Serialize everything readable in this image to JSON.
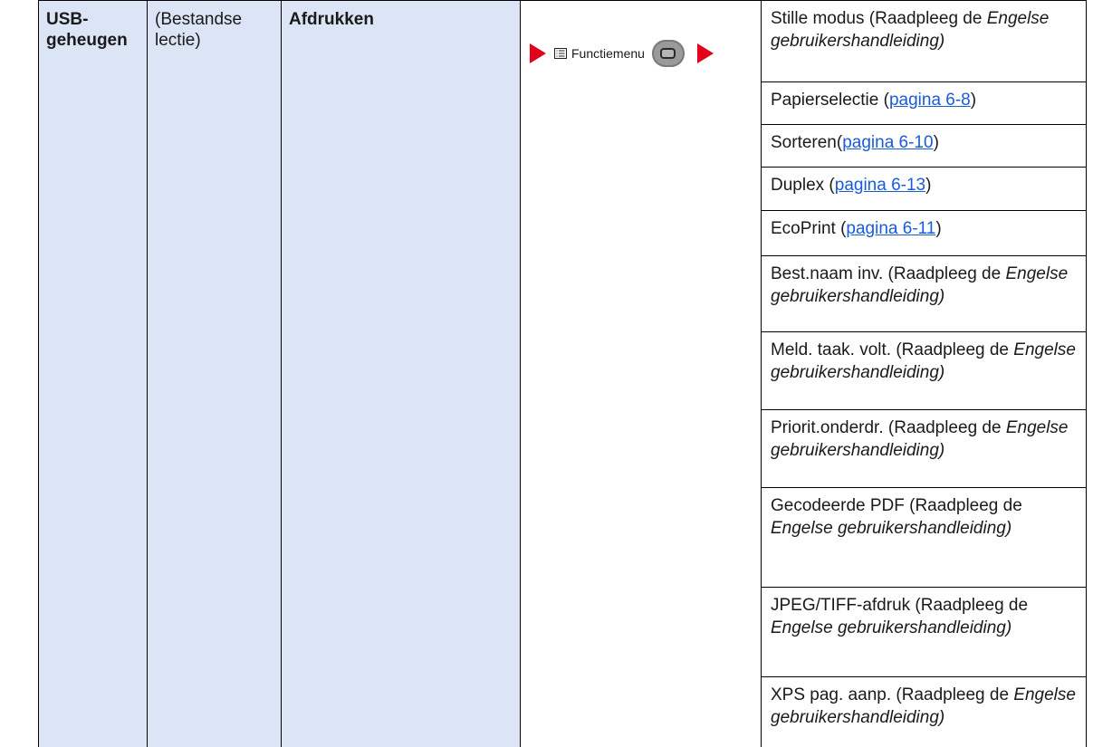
{
  "columns": {
    "c1_label": "USB-\ngeheugen",
    "c2_label": "(Bestandse\nlectie)",
    "c3_label": "Afdrukken"
  },
  "menu": {
    "label": "Functiemenu"
  },
  "items": [
    {
      "pre": "Stille modus (Raadpleeg de",
      "em": "Engelse gebruikershandleiding)",
      "link": "",
      "post": ""
    },
    {
      "pre": "Papierselectie (",
      "link": "pagina 6-8",
      "post": ")",
      "em": ""
    },
    {
      "pre": "Sorteren(",
      "link": "pagina 6-10",
      "post": ")",
      "em": ""
    },
    {
      "pre": "Duplex (",
      "link": "pagina 6-13",
      "post": ")",
      "em": ""
    },
    {
      "pre": "EcoPrint (",
      "link": "pagina 6-11",
      "post": ")",
      "em": ""
    },
    {
      "pre": "Best.naam inv. (Raadpleeg de",
      "em": "Engelse gebruikershandleiding)",
      "link": "",
      "post": ""
    },
    {
      "pre": "Meld. taak. volt. (Raadpleeg de",
      "em": "Engelse gebruikershandleiding)",
      "link": "",
      "post": ""
    },
    {
      "pre": "Priorit.onderdr. (Raadpleeg de",
      "em": "Engelse gebruikershandleiding)",
      "link": "",
      "post": ""
    },
    {
      "pre": "Gecodeerde PDF (Raadpleeg de",
      "em": "Engelse gebruikershandleiding)",
      "link": "",
      "post": ""
    },
    {
      "pre": "JPEG/TIFF-afdruk (Raadpleeg de",
      "em": "Engelse gebruikershandleiding)",
      "link": "",
      "post": ""
    },
    {
      "pre": "XPS pag. aanp. (Raadpleeg de",
      "em": "Engelse gebruikershandleiding)",
      "link": "",
      "post": ""
    }
  ]
}
